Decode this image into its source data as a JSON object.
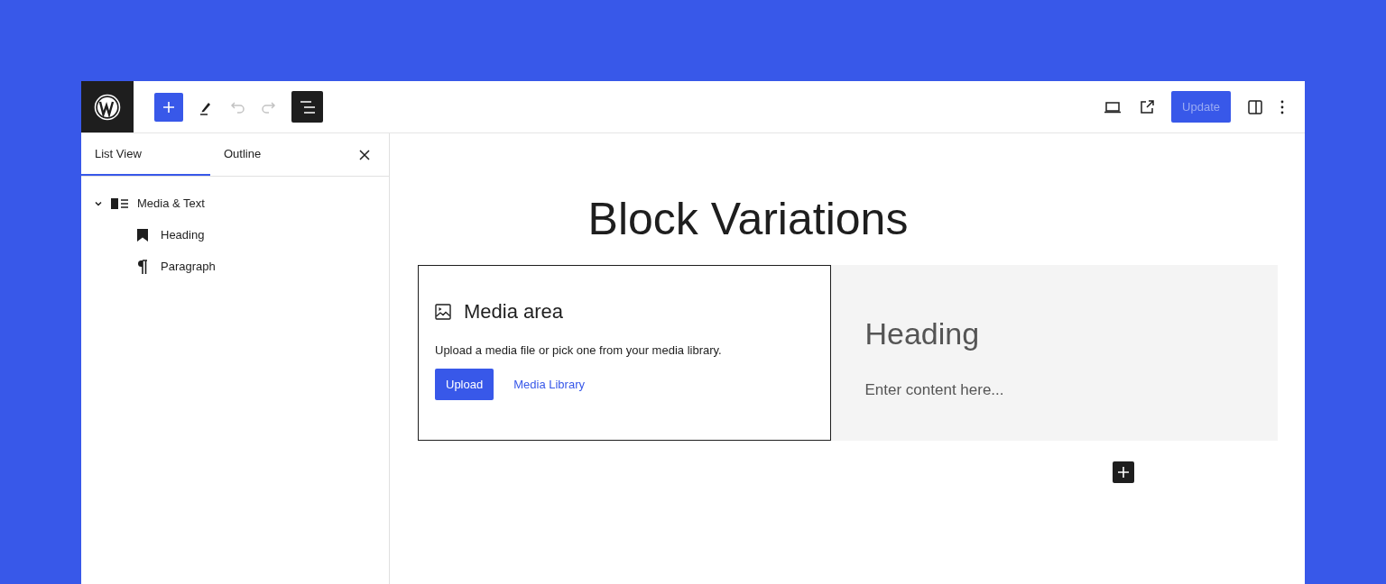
{
  "toolbar": {
    "undo": {
      "disabled": true
    },
    "redo": {
      "disabled": true
    },
    "list_view": {
      "pressed": true
    },
    "update": {
      "label": "Update",
      "disabled": true
    }
  },
  "sidebar": {
    "tabs": [
      {
        "label": "List View",
        "selected": true
      },
      {
        "label": "Outline",
        "selected": false
      }
    ],
    "tree": [
      {
        "label": "Media & Text",
        "kind": "media-text",
        "expanded": true,
        "children": [
          {
            "label": "Heading",
            "kind": "heading"
          },
          {
            "label": "Paragraph",
            "kind": "paragraph"
          }
        ]
      }
    ]
  },
  "canvas": {
    "title": "Block Variations",
    "media": {
      "title": "Media area",
      "instructions": "Upload a media file or pick one from your media library.",
      "upload": "Upload",
      "library": "Media Library"
    },
    "heading": "Heading",
    "placeholder": "Enter content here..."
  }
}
